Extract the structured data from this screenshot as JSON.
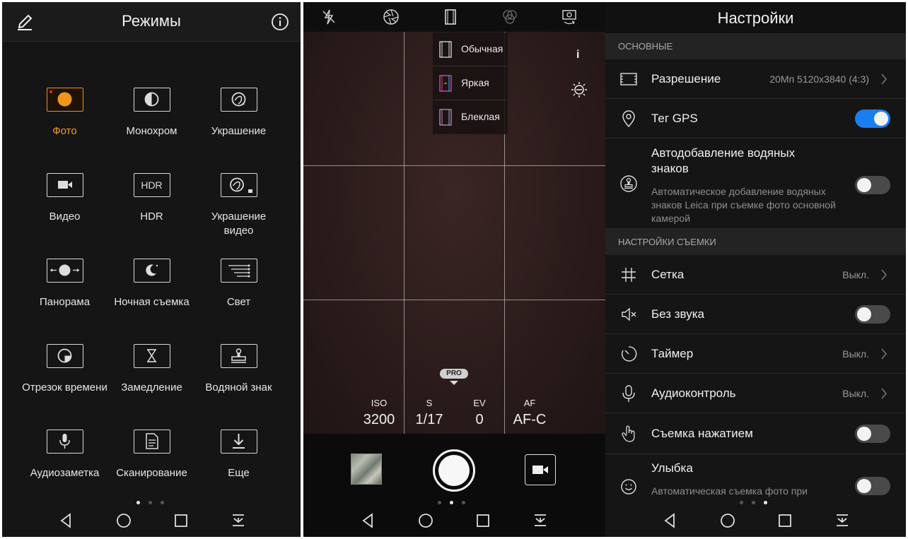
{
  "modes_screen": {
    "title": "Режимы",
    "modes": [
      {
        "label": "Фото",
        "icon": "photo-icon",
        "active": true
      },
      {
        "label": "Монохром",
        "icon": "monochrome-icon"
      },
      {
        "label": "Украшение",
        "icon": "beauty-icon"
      },
      {
        "label": "Видео",
        "icon": "video-icon"
      },
      {
        "label": "HDR",
        "icon": "hdr-icon"
      },
      {
        "label": "Украшение видео",
        "icon": "beauty-video-icon"
      },
      {
        "label": "Панорама",
        "icon": "panorama-icon"
      },
      {
        "label": "Ночная съемка",
        "icon": "night-icon"
      },
      {
        "label": "Свет",
        "icon": "light-painting-icon"
      },
      {
        "label": "Отрезок времени",
        "icon": "time-lapse-icon"
      },
      {
        "label": "Замедление",
        "icon": "slow-motion-icon"
      },
      {
        "label": "Водяной знак",
        "icon": "watermark-icon"
      },
      {
        "label": "Аудиозаметка",
        "icon": "audio-note-icon"
      },
      {
        "label": "Сканирование",
        "icon": "document-scan-icon"
      },
      {
        "label": "Еще",
        "icon": "download-more-icon"
      }
    ],
    "hdr_icon_text": "HDR",
    "page_dots": {
      "count": 3,
      "active": 0
    }
  },
  "camera_screen": {
    "filters": [
      {
        "label": "Обычная"
      },
      {
        "label": "Яркая"
      },
      {
        "label": "Блеклая"
      }
    ],
    "info_label": "i",
    "pro_label": "PRO",
    "params": [
      {
        "key": "ISO",
        "value": "3200"
      },
      {
        "key": "S",
        "value": "1/17"
      },
      {
        "key": "EV",
        "value": "0"
      },
      {
        "key": "AF",
        "value": "AF-C"
      }
    ],
    "page_dots": {
      "count": 3,
      "active": 1
    }
  },
  "settings_screen": {
    "title": "Настройки",
    "sections": [
      {
        "title": "ОСНОВНЫЕ"
      },
      {
        "title": "НАСТРОЙКИ СЪЕМКИ"
      }
    ],
    "rows": [
      {
        "label": "Разрешение",
        "value": "20Мп 5120x3840 (4:3)",
        "icon": "resolution-icon"
      },
      {
        "label": "Тег GPS",
        "toggle": true,
        "icon": "location-pin-icon"
      },
      {
        "label": "Автодобавление водяных знаков",
        "description": "Автоматическое добавление водяных знаков Leica при съемке фото основной камерой",
        "toggle": false,
        "icon": "stamp-icon"
      },
      {
        "label": "Сетка",
        "value": "Выкл.",
        "icon": "grid-icon"
      },
      {
        "label": "Без звука",
        "toggle": false,
        "icon": "mute-icon"
      },
      {
        "label": "Таймер",
        "value": "Выкл.",
        "icon": "timer-icon"
      },
      {
        "label": "Аудиоконтроль",
        "value": "Выкл.",
        "icon": "microphone-icon"
      },
      {
        "label": "Съемка нажатием",
        "toggle": false,
        "icon": "touch-icon"
      },
      {
        "label": "Улыбка",
        "description": "Автоматическая съемка фото при",
        "toggle": false,
        "icon": "smile-icon"
      }
    ],
    "page_dots": {
      "count": 3,
      "active": 2
    }
  },
  "colors": {
    "accent_orange": "#ef9a2d",
    "toggle_on": "#1a7ef0"
  }
}
